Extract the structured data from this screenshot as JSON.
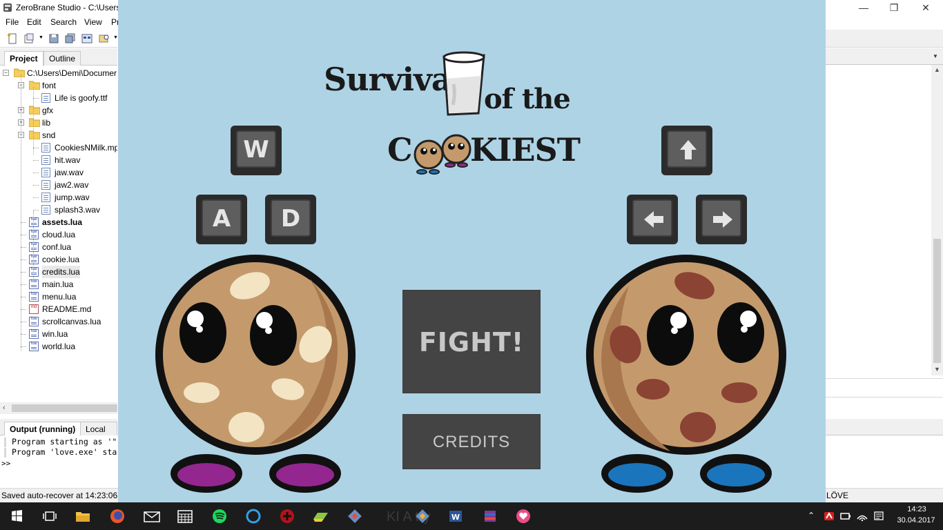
{
  "ide": {
    "title": "ZeroBrane Studio - C:\\Users",
    "menu": [
      "File",
      "Edit",
      "Search",
      "View",
      "Pr"
    ],
    "panel_tabs": [
      "Project",
      "Outline"
    ],
    "tree": [
      {
        "label": "C:\\Users\\Demi\\Documer",
        "type": "folder",
        "level": 0,
        "expander": "−"
      },
      {
        "label": "font",
        "type": "folder",
        "level": 1,
        "expander": "−"
      },
      {
        "label": "Life is goofy.ttf",
        "type": "file",
        "level": 2
      },
      {
        "label": "gfx",
        "type": "folder",
        "level": 1,
        "expander": "+"
      },
      {
        "label": "lib",
        "type": "folder",
        "level": 1,
        "expander": "+"
      },
      {
        "label": "snd",
        "type": "folder",
        "level": 1,
        "expander": "−"
      },
      {
        "label": "CookiesNMilk.mp",
        "type": "file",
        "level": 2
      },
      {
        "label": "hit.wav",
        "type": "file",
        "level": 2
      },
      {
        "label": "jaw.wav",
        "type": "file",
        "level": 2
      },
      {
        "label": "jaw2.wav",
        "type": "file",
        "level": 2
      },
      {
        "label": "jump.wav",
        "type": "file",
        "level": 2
      },
      {
        "label": "splash3.wav",
        "type": "file",
        "level": 2
      },
      {
        "label": "assets.lua",
        "type": "lua",
        "level": 1,
        "bold": true
      },
      {
        "label": "cloud.lua",
        "type": "lua",
        "level": 1
      },
      {
        "label": "conf.lua",
        "type": "lua",
        "level": 1
      },
      {
        "label": "cookie.lua",
        "type": "lua",
        "level": 1
      },
      {
        "label": "credits.lua",
        "type": "lua",
        "level": 1,
        "selected": true
      },
      {
        "label": "main.lua",
        "type": "lua",
        "level": 1
      },
      {
        "label": "menu.lua",
        "type": "lua",
        "level": 1
      },
      {
        "label": "README.md",
        "type": "md",
        "level": 1
      },
      {
        "label": "scrollcanvas.lua",
        "type": "lua",
        "level": 1
      },
      {
        "label": "win.lua",
        "type": "lua",
        "level": 1
      },
      {
        "label": "world.lua",
        "type": "lua",
        "level": 1
      }
    ],
    "output_tabs": [
      "Output (running)",
      "Local cor"
    ],
    "output_lines": [
      "Program starting as '\"",
      "Program 'love.exe' sta"
    ],
    "output_prompt": ">>",
    "status": "Saved auto-recover at 14:23:06.",
    "status_right": "LÖVE",
    "window_controls": {
      "minimize": "—",
      "maximize": "❐",
      "close": "✕"
    }
  },
  "game": {
    "title_line1": "Survival",
    "title_line2": "of the",
    "title_c": "C",
    "title_kiest": "KIEST",
    "keys_left": {
      "up": "W",
      "left": "A",
      "right": "D"
    },
    "fight_label": "FIGHT!",
    "credits_label": "CREDITS",
    "colors": {
      "background": "#aed3e5",
      "cookie": "#c49a6c",
      "cookie_shade": "#a9774d",
      "button": "#444444",
      "button_text": "#c8c8c8",
      "purple_shoe": "#93278f",
      "blue_shoe": "#1b75bc"
    }
  },
  "taskbar": {
    "ghost_text": "KI A     try",
    "time": "14:23",
    "date": "30.04.2017",
    "icons": [
      "windows-start-icon",
      "task-view-icon",
      "file-explorer-icon",
      "firefox-icon",
      "mail-icon",
      "calendar-icon",
      "spotify-icon",
      "cortana-icon",
      "game-icon",
      "photos-icon",
      "git-icon",
      "git-icon-2",
      "word-icon",
      "winrar-icon",
      "love-icon"
    ]
  }
}
